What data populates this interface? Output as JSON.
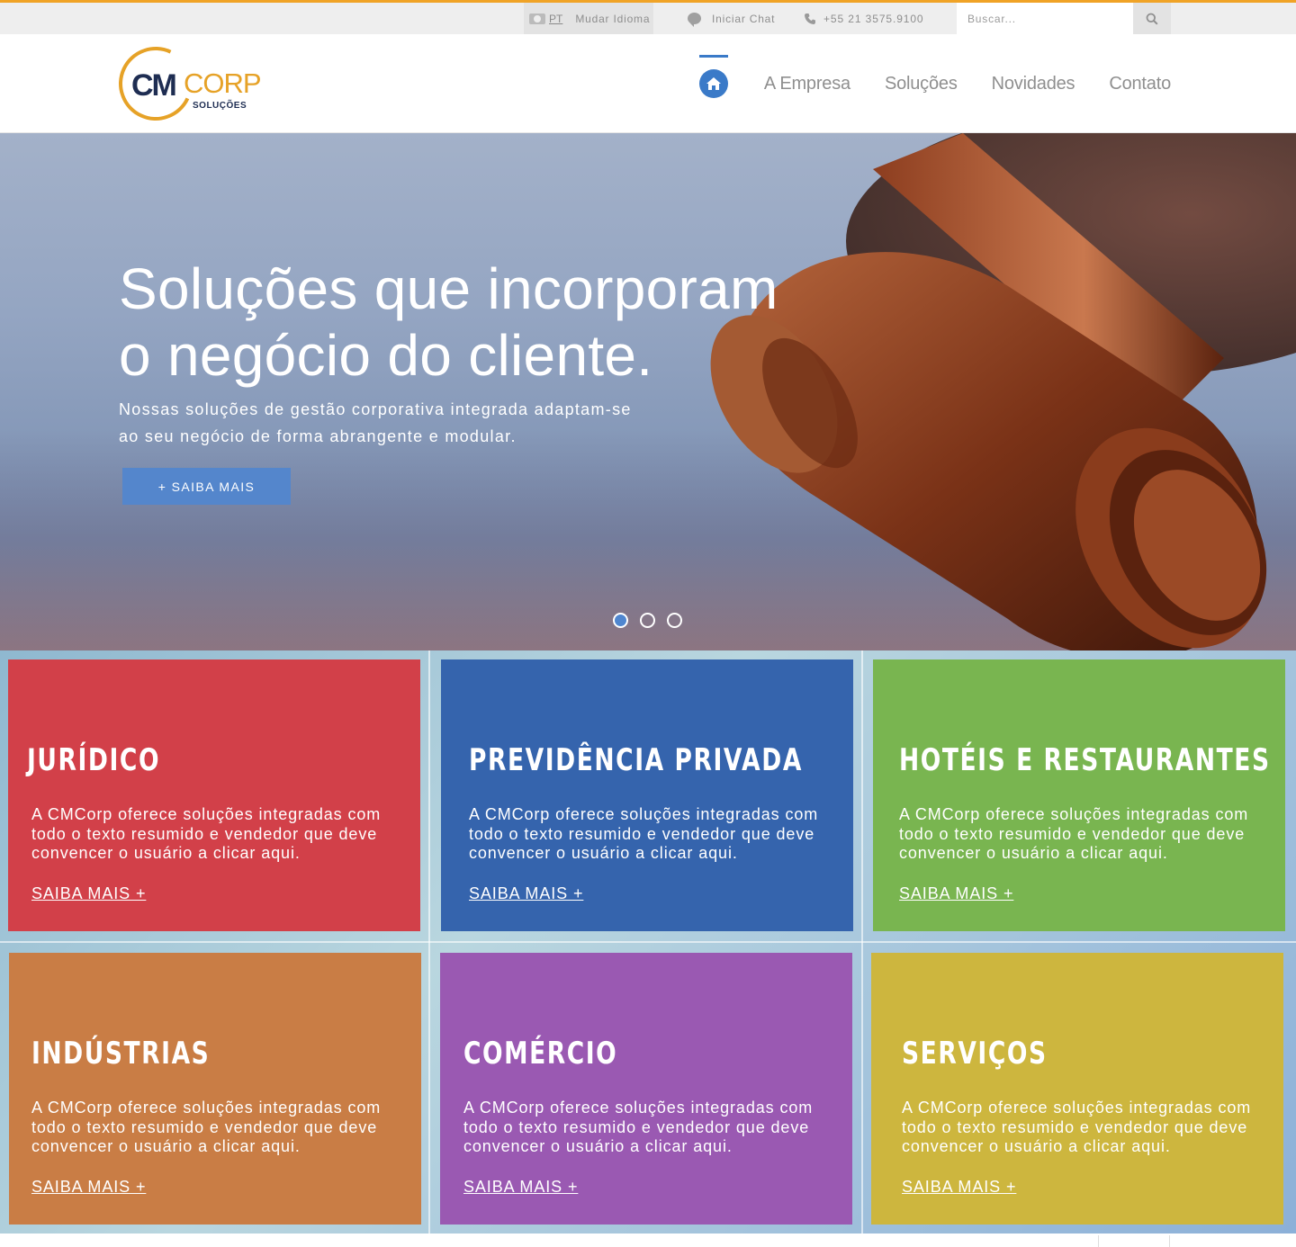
{
  "topbar": {
    "lang_code": "PT",
    "lang_label": "Mudar Idioma",
    "chat_label": "Iniciar Chat",
    "phone": "+55 21 3575.9100",
    "search_placeholder": "Buscar..."
  },
  "logo": {
    "cm": "CM",
    "corp": "CORP",
    "sub": "SOLUÇÕES"
  },
  "nav": {
    "items": [
      {
        "label": "A Empresa"
      },
      {
        "label": "Soluções"
      },
      {
        "label": "Novidades"
      },
      {
        "label": "Contato"
      }
    ],
    "active": "home"
  },
  "hero": {
    "title_line1": "Soluções que incorporam",
    "title_line2": "o negócio do cliente.",
    "text_line1": "Nossas soluções de gestão corporativa integrada adaptam-se",
    "text_line2": "ao seu negócio de forma abrangente e modular.",
    "button_label": "+ SAIBA MAIS",
    "slides_total": 3,
    "slide_active": 1
  },
  "tiles": [
    {
      "title": "Jurídico",
      "color": "#d24049",
      "text": "A CMCorp oferece soluções integradas com todo o texto resumido e vendedor que deve convencer o usuário a clicar aqui.",
      "link": "SAIBA MAIS +"
    },
    {
      "title": "Previdência Privada",
      "color": "#3564ad",
      "text": "A CMCorp oferece soluções integradas com todo o texto resumido e vendedor que deve convencer o usuário a clicar aqui.",
      "link": "SAIBA MAIS +"
    },
    {
      "title": "Hotéis e Restaurantes",
      "color": "#79b550",
      "text": "A CMCorp oferece soluções integradas com todo o texto resumido e vendedor que deve convencer o usuário a clicar aqui.",
      "link": "SAIBA MAIS +"
    },
    {
      "title": "Indústrias",
      "color": "#c97d45",
      "text": "A CMCorp oferece soluções integradas com todo o texto resumido e vendedor que deve convencer o usuário a clicar aqui.",
      "link": "SAIBA MAIS +"
    },
    {
      "title": "Comércio",
      "color": "#9a59b2",
      "text": "A CMCorp oferece soluções integradas com todo o texto resumido e vendedor que deve convencer o usuário a clicar aqui.",
      "link": "SAIBA MAIS +"
    },
    {
      "title": "Serviços",
      "color": "#cdb63e",
      "text": "A CMCorp oferece soluções integradas com todo o texto resumido e vendedor que deve convencer o usuário a clicar aqui.",
      "link": "SAIBA MAIS +"
    }
  ],
  "colors": {
    "accent": "#f0a326",
    "primary_blue": "#3a7ac8",
    "button_blue": "#5486cc",
    "logo_navy": "#1e2d52"
  }
}
